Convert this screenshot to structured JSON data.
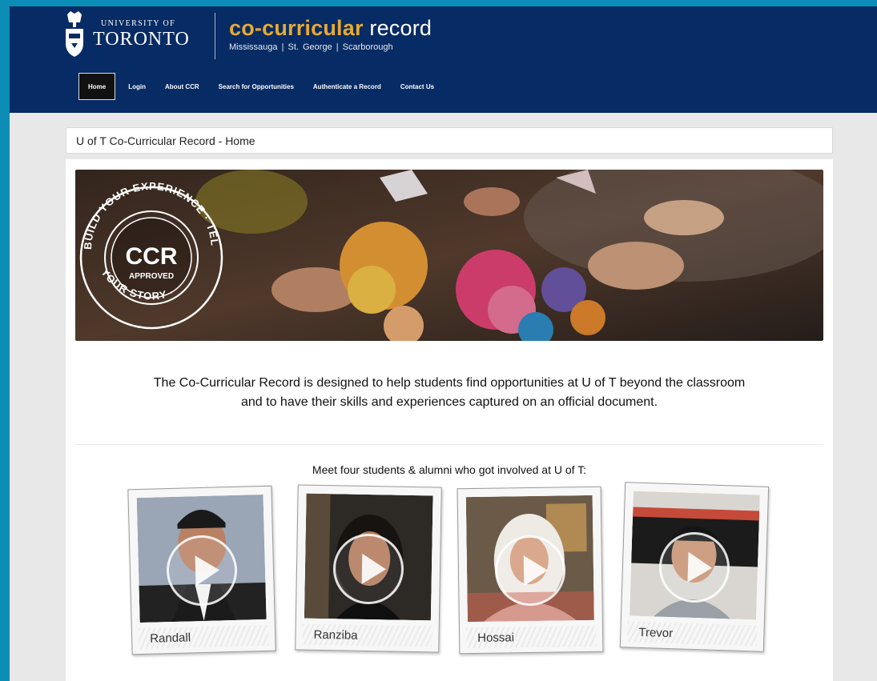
{
  "header": {
    "university_small": "UNIVERSITY OF",
    "university_big": "TORONTO",
    "title_accent": "co-curricular",
    "title_rest": " record",
    "campuses": "Mississauga  |  St. George  |  Scarborough"
  },
  "nav": {
    "items": [
      {
        "label": "Home",
        "active": true
      },
      {
        "label": "Login"
      },
      {
        "label": "About CCR"
      },
      {
        "label": "Search for Opportunities"
      },
      {
        "label": "Authenticate a Record"
      },
      {
        "label": "Contact Us"
      }
    ]
  },
  "breadcrumb": "U of T Co-Curricular Record - Home",
  "banner": {
    "badge_center": "CCR",
    "badge_sub": "APPROVED",
    "badge_ring_top": "BUILD YOUR EXPERIENCE · TELL",
    "badge_ring_bottom": "YOUR STORY ·"
  },
  "intro": {
    "line1": "The Co-Curricular Record is designed to help students find opportunities at U of T beyond the classroom",
    "line2": "and to have their skills and experiences captured on an official document."
  },
  "meet_heading": "Meet four students & alumni who got involved at U of T:",
  "videos": [
    {
      "name": "Randall"
    },
    {
      "name": "Ranziba"
    },
    {
      "name": "Hossai"
    },
    {
      "name": "Trevor"
    }
  ],
  "colors": {
    "header_bg": "#072b64",
    "accent_gold": "#e8a933",
    "outer_bg": "#0b8db5"
  }
}
